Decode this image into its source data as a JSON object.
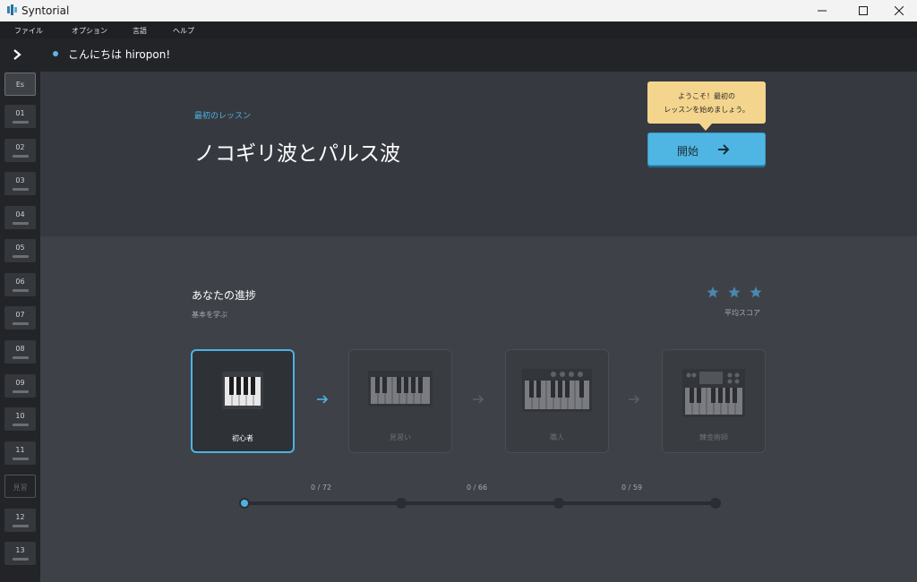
{
  "window": {
    "title": "Syntorial"
  },
  "menu": [
    "ファイル",
    "オプション",
    "言語",
    "ヘルプ"
  ],
  "sidebar": {
    "items": [
      {
        "label": "Es",
        "kind": "es"
      },
      {
        "label": "01"
      },
      {
        "label": "02"
      },
      {
        "label": "03"
      },
      {
        "label": "04"
      },
      {
        "label": "05"
      },
      {
        "label": "06"
      },
      {
        "label": "07"
      },
      {
        "label": "08"
      },
      {
        "label": "09"
      },
      {
        "label": "10"
      },
      {
        "label": "11"
      },
      {
        "label": "見習",
        "kind": "trial"
      },
      {
        "label": "12"
      },
      {
        "label": "13"
      }
    ]
  },
  "greeting": {
    "text": "こんにちは hiropon!"
  },
  "hero": {
    "kicker": "最初のレッスン",
    "heading": "ノコギリ波とパルス波",
    "tooltip_line1": "ようこそ！最初の",
    "tooltip_line2": "レッスンを始めましょう。",
    "start_label": "開始"
  },
  "progress": {
    "title": "あなたの進捗",
    "subtitle": "基本を学ぶ",
    "avg_label": "平均スコア",
    "stars": 3,
    "stages": [
      {
        "label": "初心者",
        "active": true
      },
      {
        "label": "見習い",
        "active": false
      },
      {
        "label": "職人",
        "active": false
      },
      {
        "label": "錬金術師",
        "active": false
      }
    ],
    "counts": [
      "0 / 72",
      "0 / 66",
      "0 / 59"
    ]
  },
  "colors": {
    "accent": "#4fb2e2",
    "tooltip": "#f4d58d",
    "button": "#4fb6e3"
  }
}
